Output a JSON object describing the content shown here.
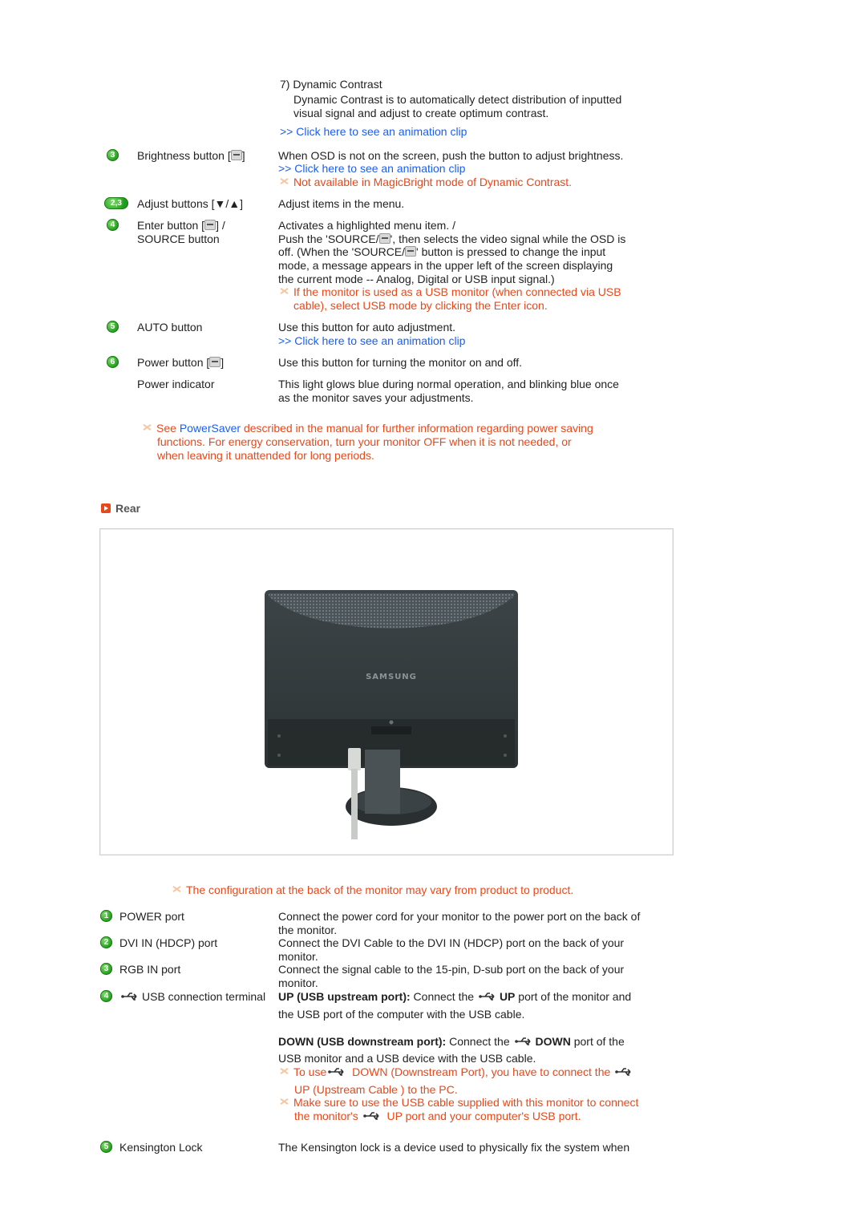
{
  "top_section": {
    "dynamic_contrast": {
      "heading": "7) Dynamic Contrast",
      "desc_line1": "Dynamic Contrast is to automatically detect distribution of inputted",
      "desc_line2": "visual signal and adjust to create optimum contrast.",
      "link": ">> Click here to see an animation clip"
    },
    "items": [
      {
        "badge": "3",
        "label": "Brightness button [",
        "label_suffix": "]",
        "icon": "brightness-icon",
        "desc": "When OSD is not on the screen, push the button to adjust brightness.",
        "link": ">> Click here to see an animation clip",
        "note": "Not available in MagicBright mode of Dynamic Contrast."
      },
      {
        "badge": "2,3",
        "label": "Adjust buttons [▼/▲]",
        "desc": "Adjust items in the menu."
      },
      {
        "badge": "4",
        "label_line1": "Enter button [",
        "label_line1_suffix": "] /",
        "label_line2": "SOURCE button",
        "icon": "enter-icon",
        "desc_line1": "Activates a highlighted menu item. /",
        "desc_line2a": "Push the 'SOURCE/",
        "desc_line2b": "', then selects the video signal while the OSD is",
        "desc_line3a": "off. (When the 'SOURCE/",
        "desc_line3b": "' button is pressed to change the input",
        "desc_line4": "mode, a message appears in the upper left of the screen displaying",
        "desc_line5": "the current mode -- Analog, Digital or USB input signal.)",
        "note_line1": "If the monitor is used as a USB monitor (when connected via USB",
        "note_line2": "cable), select USB mode by clicking the Enter icon."
      },
      {
        "badge": "5",
        "label": "AUTO button",
        "desc": "Use this button for auto adjustment.",
        "link": ">> Click here to see an animation clip"
      },
      {
        "badge": "6",
        "label": "Power button [",
        "label_suffix": "]",
        "icon": "power-icon",
        "desc": "Use this button for turning the monitor on and off."
      },
      {
        "label": "Power indicator",
        "desc_line1": "This light glows blue during normal operation, and blinking blue once",
        "desc_line2": "as the monitor saves your adjustments."
      }
    ],
    "powersaver_note": {
      "prefix": "See ",
      "link": "PowerSaver",
      "line1_rest": " described in the manual for further information regarding power saving",
      "line2": "functions. For energy conservation, turn your monitor OFF when it is not needed, or",
      "line3": "when leaving it unattended for long periods."
    }
  },
  "rear_section": {
    "title": "Rear",
    "image_alt": "Rear view of Samsung monitor",
    "brand_text": "SAMSUNG",
    "config_note": "The configuration at the back of the monitor may vary from product to product.",
    "ports": [
      {
        "badge": "1",
        "label": "POWER port",
        "desc_line1": "Connect the power cord for your monitor to the power port on the back of",
        "desc_line2": "the monitor."
      },
      {
        "badge": "2",
        "label": "DVI IN (HDCP) port",
        "desc_line1": "Connect the DVI Cable to the DVI IN (HDCP) port on the back of your",
        "desc_line2": "monitor."
      },
      {
        "badge": "3",
        "label": "RGB IN port",
        "desc_line1": "Connect the signal cable to the 15-pin, D-sub port on the back of your",
        "desc_line2": "monitor."
      },
      {
        "badge": "4",
        "label": "USB connection terminal",
        "up_bold": "UP (USB upstream port):",
        "up_text1": " Connect the ",
        "up_bold2": "UP",
        "up_text2": " port of the monitor and",
        "up_line2": "the USB port of the computer with the USB cable.",
        "down_bold": "DOWN (USB downstream port):",
        "down_text1": " Connect the ",
        "down_bold2": "DOWN",
        "down_text2": " port of the",
        "down_line2": "USB monitor and a USB device with the USB cable.",
        "note1_a": "To use",
        "note1_b": " DOWN (Downstream Port), you have to connect the ",
        "note1_line2": "UP (Upstream Cable ) to the PC.",
        "note2_line1": "Make sure to use the USB cable supplied with this monitor to connect",
        "note2_a": "the monitor's ",
        "note2_b": " UP port and your computer's USB port."
      },
      {
        "badge": "5",
        "label": "Kensington Lock",
        "desc_line1": "The Kensington lock is a device used to physically fix the system when"
      }
    ]
  },
  "colors": {
    "link": "#1a5ef0",
    "note": "#e8481a",
    "badge_green": "#1f9a1a",
    "text": "#222222"
  }
}
